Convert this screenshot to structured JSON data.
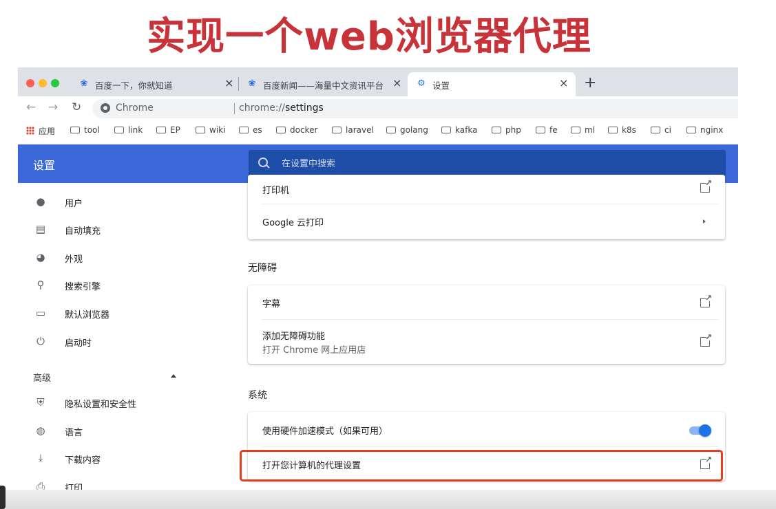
{
  "slide": {
    "title": "实现一个web浏览器代理"
  },
  "tabs": [
    {
      "label": "百度一下，你就知道",
      "icon": "paw-icon"
    },
    {
      "label": "百度新闻——海量中文资讯平台",
      "icon": "paw-icon"
    },
    {
      "label": "设置",
      "icon": "gear-icon"
    }
  ],
  "window": {
    "close_glyph": "×",
    "new_tab_glyph": "+"
  },
  "toolbar": {
    "back_glyph": "←",
    "forward_glyph": "→",
    "reload_glyph": "↻",
    "site_label": "Chrome",
    "url_prefix": "chrome://",
    "url_path": "settings"
  },
  "bookmarks": {
    "apps_label": "应用",
    "folders": [
      "tool",
      "link",
      "EP",
      "wiki",
      "es",
      "docker",
      "laravel",
      "golang",
      "kafka",
      "php",
      "fe",
      "ml",
      "k8s",
      "ci",
      "nginx"
    ]
  },
  "header": {
    "title": "设置",
    "search_placeholder": "在设置中搜索"
  },
  "sidebar": {
    "items": [
      {
        "label": "用户",
        "icon": "person-icon"
      },
      {
        "label": "自动填充",
        "icon": "clipboard-icon"
      },
      {
        "label": "外观",
        "icon": "palette-icon"
      },
      {
        "label": "搜索引擎",
        "icon": "search-icon"
      },
      {
        "label": "默认浏览器",
        "icon": "browser-icon"
      },
      {
        "label": "启动时",
        "icon": "power-icon"
      }
    ],
    "advanced_label": "高级",
    "advanced_items": [
      {
        "label": "隐私设置和安全性",
        "icon": "shield-icon"
      },
      {
        "label": "语言",
        "icon": "globe-icon"
      },
      {
        "label": "下载内容",
        "icon": "download-icon"
      },
      {
        "label": "打印",
        "icon": "printer-icon"
      }
    ]
  },
  "main": {
    "printing_card": {
      "printers": "打印机",
      "cloud_print": "Google 云打印"
    },
    "accessibility": {
      "title": "无障碍",
      "captions": "字幕",
      "add_features": "添加无障碍功能",
      "add_features_sub": "打开 Chrome 网上应用店"
    },
    "system": {
      "title": "系统",
      "hardware_accel": "使用硬件加速模式（如果可用）",
      "hardware_accel_on": true,
      "proxy": "打开您计算机的代理设置"
    }
  },
  "colors": {
    "accent": "#3b68d8",
    "highlight": "#e53e1e",
    "title": "#c8333a",
    "toggle": "#1a73e8"
  }
}
